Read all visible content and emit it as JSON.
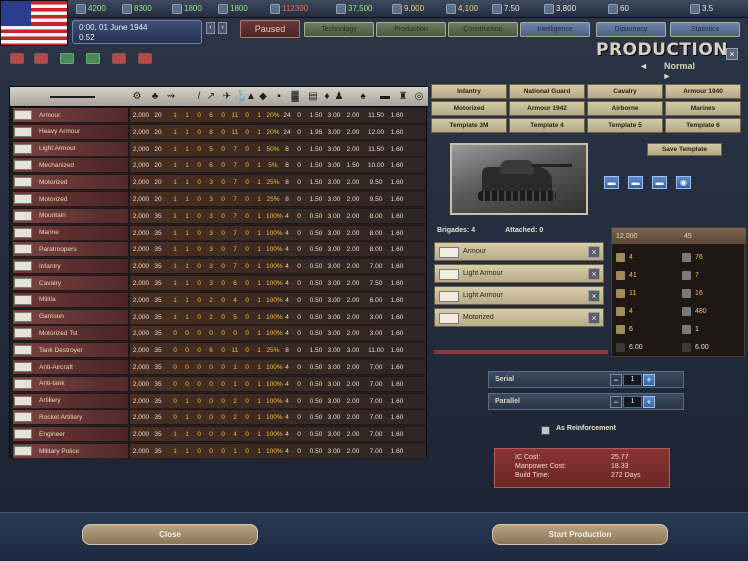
{
  "top_bar": {
    "resources": [
      {
        "label": "",
        "value": "4200"
      },
      {
        "label": "",
        "value": "8300"
      },
      {
        "label": "",
        "value": "1800"
      },
      {
        "label": "",
        "value": "1800"
      },
      {
        "label": "",
        "value": "112300"
      },
      {
        "label": "",
        "value": "37,500"
      },
      {
        "label": "",
        "value": "9,000"
      },
      {
        "label": "",
        "value": "4,100"
      },
      {
        "label": "",
        "value": "7.50"
      },
      {
        "label": "",
        "value": "3,800"
      },
      {
        "label": "",
        "value": "60"
      },
      {
        "label": "",
        "value": "3.5"
      }
    ]
  },
  "date": {
    "line1": "0:00, 01 June 1944",
    "line2": "0.52"
  },
  "paused_label": "Paused",
  "nav_tabs": [
    "Technology",
    "Production",
    "Construction",
    "Intelligence",
    "Diplomacy",
    "Statistics"
  ],
  "title": {
    "main": "PRODUCTION",
    "sub": "Normal",
    "prev": "◄",
    "next": "►",
    "close": "×"
  },
  "unit_table": {
    "rows": [
      {
        "name": "Armour",
        "cost": "2,000",
        "c1": "20",
        "vals": [
          "1",
          "1",
          "0",
          "6",
          "0",
          "11",
          "0",
          "1",
          "20%",
          "24",
          "0",
          "1.50",
          "3.00",
          "2.00",
          "11.50",
          "1.60"
        ]
      },
      {
        "name": "Heavy Armour",
        "cost": "2,000",
        "c1": "20",
        "vals": [
          "1",
          "1",
          "0",
          "8",
          "0",
          "11",
          "0",
          "1",
          "20%",
          "24",
          "0",
          "1.95",
          "3.00",
          "2.00",
          "12.00",
          "1.60"
        ]
      },
      {
        "name": "Light Armour",
        "cost": "2,000",
        "c1": "20",
        "vals": [
          "1",
          "1",
          "0",
          "5",
          "0",
          "7",
          "0",
          "1",
          "50%",
          "8",
          "0",
          "1.50",
          "3.00",
          "2.00",
          "11.50",
          "1.60"
        ]
      },
      {
        "name": "Mechanized",
        "cost": "2,000",
        "c1": "20",
        "vals": [
          "1",
          "1",
          "0",
          "6",
          "0",
          "7",
          "0",
          "1",
          "5%",
          "8",
          "0",
          "1.50",
          "3.00",
          "1.50",
          "10.00",
          "1.60"
        ]
      },
      {
        "name": "Motorized",
        "cost": "2,000",
        "c1": "20",
        "vals": [
          "1",
          "1",
          "0",
          "3",
          "0",
          "7",
          "0",
          "1",
          "25%",
          "8",
          "0",
          "1.50",
          "3.00",
          "2.00",
          "9.50",
          "1.60"
        ]
      },
      {
        "name": "Motorized",
        "cost": "2,000",
        "c1": "20",
        "vals": [
          "1",
          "1",
          "0",
          "3",
          "0",
          "7",
          "0",
          "1",
          "25%",
          "8",
          "0",
          "1.50",
          "3.00",
          "2.00",
          "9.50",
          "1.60"
        ]
      },
      {
        "name": "Mountain",
        "cost": "2,000",
        "c1": "35",
        "vals": [
          "1",
          "1",
          "0",
          "3",
          "0",
          "7",
          "0",
          "1",
          "100%",
          "4",
          "0",
          "0.50",
          "3.00",
          "2.00",
          "8.00",
          "1.60"
        ]
      },
      {
        "name": "Marine",
        "cost": "2,000",
        "c1": "35",
        "vals": [
          "1",
          "1",
          "0",
          "3",
          "0",
          "7",
          "0",
          "1",
          "100%",
          "4",
          "0",
          "0.50",
          "3.00",
          "2.00",
          "8.00",
          "1.60"
        ]
      },
      {
        "name": "Paratroopers",
        "cost": "2,000",
        "c1": "35",
        "vals": [
          "1",
          "1",
          "0",
          "3",
          "0",
          "7",
          "0",
          "1",
          "100%",
          "4",
          "0",
          "0.50",
          "3.00",
          "2.00",
          "8.00",
          "1.60"
        ]
      },
      {
        "name": "Infantry",
        "cost": "2,000",
        "c1": "35",
        "vals": [
          "1",
          "1",
          "0",
          "3",
          "0",
          "7",
          "0",
          "1",
          "100%",
          "4",
          "0",
          "0.50",
          "3.00",
          "2.00",
          "7.00",
          "1.60"
        ]
      },
      {
        "name": "Cavalry",
        "cost": "2,000",
        "c1": "35",
        "vals": [
          "1",
          "1",
          "0",
          "3",
          "0",
          "6",
          "0",
          "1",
          "100%",
          "4",
          "0",
          "0.50",
          "3.00",
          "2.00",
          "7.50",
          "1.60"
        ]
      },
      {
        "name": "Militia",
        "cost": "2,000",
        "c1": "35",
        "vals": [
          "1",
          "1",
          "0",
          "2",
          "0",
          "4",
          "0",
          "1",
          "100%",
          "4",
          "0",
          "0.50",
          "3.00",
          "2.00",
          "6.00",
          "1.60"
        ]
      },
      {
        "name": "Garrison",
        "cost": "2,000",
        "c1": "35",
        "vals": [
          "1",
          "1",
          "0",
          "2",
          "0",
          "5",
          "0",
          "1",
          "100%",
          "4",
          "0",
          "0.50",
          "3.00",
          "2.00",
          "3.00",
          "1.60"
        ]
      },
      {
        "name": "Motorized Tst",
        "cost": "2,000",
        "c1": "35",
        "vals": [
          "0",
          "0",
          "0",
          "0",
          "0",
          "0",
          "0",
          "1",
          "100%",
          "4",
          "0",
          "0.50",
          "3.00",
          "2.00",
          "3.00",
          "1.60"
        ]
      },
      {
        "name": "Tank Destroyer",
        "cost": "2,000",
        "c1": "35",
        "vals": [
          "0",
          "0",
          "0",
          "6",
          "0",
          "11",
          "0",
          "1",
          "25%",
          "8",
          "0",
          "1.50",
          "3.00",
          "3.00",
          "11.00",
          "1.60"
        ]
      },
      {
        "name": "Anti-Aircraft",
        "cost": "2,000",
        "c1": "35",
        "vals": [
          "0",
          "0",
          "0",
          "0",
          "0",
          "1",
          "0",
          "1",
          "100%",
          "4",
          "0",
          "0.50",
          "3.00",
          "2.00",
          "7.00",
          "1.60"
        ]
      },
      {
        "name": "Anti-tank",
        "cost": "2,000",
        "c1": "35",
        "vals": [
          "0",
          "0",
          "0",
          "0",
          "0",
          "1",
          "0",
          "1",
          "100%",
          "4",
          "0",
          "0.50",
          "3.00",
          "2.00",
          "7.00",
          "1.60"
        ]
      },
      {
        "name": "Artillery",
        "cost": "2,000",
        "c1": "35",
        "vals": [
          "0",
          "1",
          "0",
          "0",
          "0",
          "2",
          "0",
          "1",
          "100%",
          "4",
          "0",
          "0.50",
          "3.00",
          "2.00",
          "7.00",
          "1.60"
        ]
      },
      {
        "name": "Rocket Artillery",
        "cost": "2,000",
        "c1": "35",
        "vals": [
          "0",
          "1",
          "0",
          "0",
          "0",
          "2",
          "0",
          "1",
          "100%",
          "4",
          "0",
          "0.50",
          "3.00",
          "2.00",
          "7.00",
          "1.60"
        ]
      },
      {
        "name": "Engineer",
        "cost": "2,000",
        "c1": "35",
        "vals": [
          "1",
          "1",
          "0",
          "0",
          "0",
          "4",
          "0",
          "1",
          "100%",
          "4",
          "0",
          "0.50",
          "3.00",
          "2.00",
          "7.00",
          "1.60"
        ]
      },
      {
        "name": "Military Police",
        "cost": "2,000",
        "c1": "35",
        "vals": [
          "1",
          "1",
          "0",
          "0",
          "0",
          "1",
          "0",
          "1",
          "100%",
          "4",
          "0",
          "0.50",
          "3.00",
          "2.00",
          "7.00",
          "1.60"
        ]
      }
    ]
  },
  "categories": [
    "Infantry",
    "National Guard",
    "Cavalry",
    "Armour 1940",
    "Motorized",
    "Armour 1942",
    "Airborne",
    "Marines",
    "Template 3M",
    "Template 4",
    "Template 5",
    "Template 6"
  ],
  "save_template_label": "Save Template",
  "brigade_header": {
    "brigades_label": "Brigades: 4",
    "attached_label": "Attached: 0"
  },
  "brigades": [
    {
      "name": "Armour"
    },
    {
      "name": "Light Armour"
    },
    {
      "name": "Light Armour"
    },
    {
      "name": "Motorized"
    }
  ],
  "stats": {
    "header_left": "12,000",
    "header_right": "45",
    "rows": [
      {
        "left": "4",
        "right": "76"
      },
      {
        "left": "41",
        "right": "7"
      },
      {
        "left": "11",
        "right": "16"
      },
      {
        "left": "4",
        "right": "480"
      },
      {
        "left": "6",
        "right": "1"
      },
      {
        "left": "6.00",
        "right": "6.00"
      }
    ]
  },
  "counters": [
    {
      "label": "Serial",
      "value": "1"
    },
    {
      "label": "Parallel",
      "value": "1"
    }
  ],
  "as_reinforcement_label": "As Reinforcement",
  "cost": {
    "rows": [
      {
        "key": "IC Cost:",
        "value": "25.77"
      },
      {
        "key": "Manpower Cost:",
        "value": "18.33"
      },
      {
        "key": "Build Time:",
        "value": "272 Days"
      }
    ]
  },
  "buttons": {
    "close": "Close",
    "start": "Start Production"
  }
}
